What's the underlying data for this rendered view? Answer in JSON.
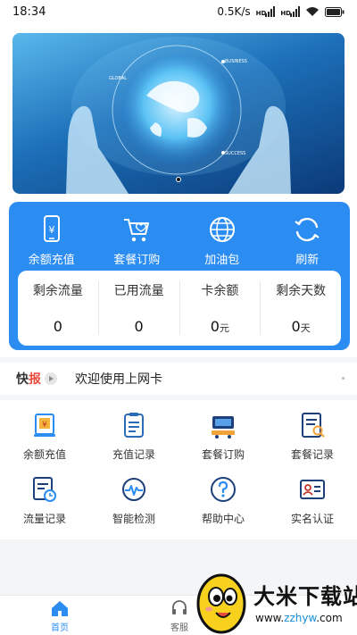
{
  "status_bar": {
    "time": "18:34",
    "speed": "0.5K/s"
  },
  "banner": {
    "labels": [
      "GLOBAL",
      "BUSINESS",
      "SUCCESS"
    ],
    "slide_count": 1
  },
  "quick_actions": [
    {
      "label": "余额充值",
      "icon": "phone-yuan-icon"
    },
    {
      "label": "套餐订购",
      "icon": "cart-icon"
    },
    {
      "label": "加油包",
      "icon": "globe-icon"
    },
    {
      "label": "刷新",
      "icon": "refresh-icon"
    }
  ],
  "stats": [
    {
      "label": "剩余流量",
      "value": "0",
      "unit": ""
    },
    {
      "label": "已用流量",
      "value": "0",
      "unit": ""
    },
    {
      "label": "卡余额",
      "value": "0",
      "unit": "元"
    },
    {
      "label": "剩余天数",
      "value": "0",
      "unit": "天"
    }
  ],
  "news": {
    "logo_a": "快",
    "logo_b": "报",
    "text": "欢迎使用上网卡"
  },
  "grid": [
    {
      "label": "余额充值",
      "icon": "recharge-icon"
    },
    {
      "label": "充值记录",
      "icon": "recharge-record-icon"
    },
    {
      "label": "套餐订购",
      "icon": "package-order-icon"
    },
    {
      "label": "套餐记录",
      "icon": "package-record-icon"
    },
    {
      "label": "流量记录",
      "icon": "traffic-record-icon"
    },
    {
      "label": "智能检测",
      "icon": "smart-detect-icon"
    },
    {
      "label": "帮助中心",
      "icon": "help-icon"
    },
    {
      "label": "实名认证",
      "icon": "id-verify-icon"
    }
  ],
  "tabbar": [
    {
      "label": "首页",
      "active": true
    },
    {
      "label": "客服",
      "active": false
    }
  ],
  "watermark": {
    "title": "大米下载站",
    "url_prefix": "www.",
    "url_brand": "zzhyw",
    "url_suffix": ".com"
  },
  "colors": {
    "primary": "#2b8cf2",
    "news_accent": "#e84b3c"
  }
}
